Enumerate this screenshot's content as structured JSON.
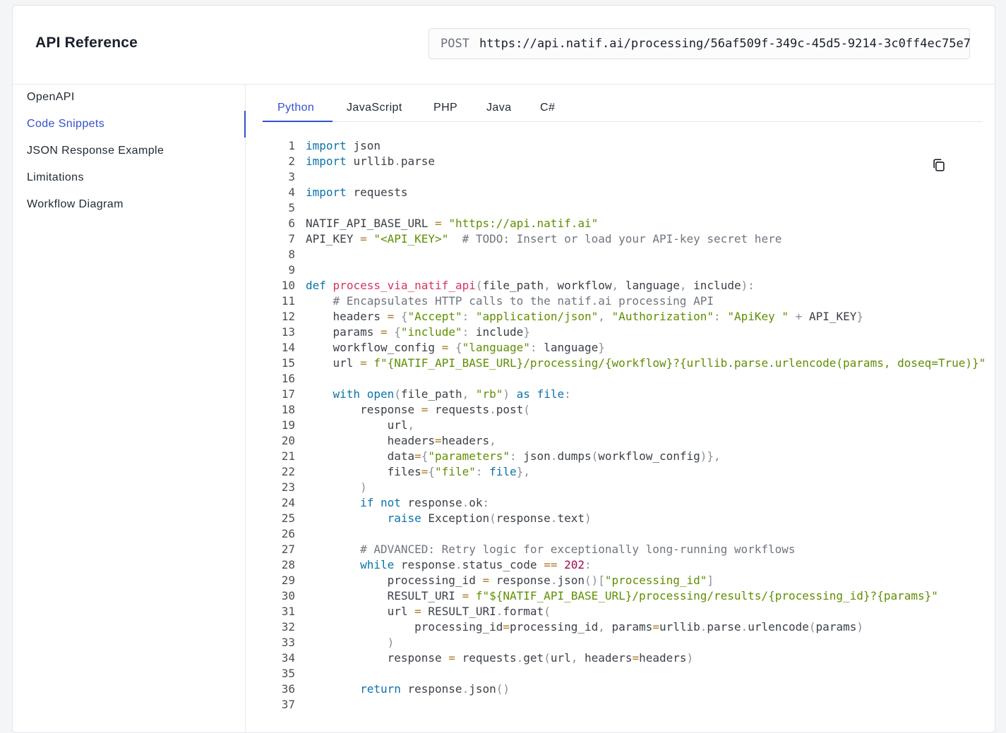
{
  "header": {
    "title": "API Reference",
    "method": "POST",
    "url": "https://api.natif.ai/processing/56af509f-349c-45d5-9214-3c0ff4ec75e7"
  },
  "sidebar": {
    "items": [
      {
        "label": "OpenAPI"
      },
      {
        "label": "Code Snippets",
        "active": true
      },
      {
        "label": "JSON Response Example"
      },
      {
        "label": "Limitations"
      },
      {
        "label": "Workflow Diagram"
      }
    ]
  },
  "tabs": [
    {
      "label": "Python",
      "active": true
    },
    {
      "label": "JavaScript"
    },
    {
      "label": "PHP"
    },
    {
      "label": "Java"
    },
    {
      "label": "C#"
    }
  ],
  "colors": {
    "accent": "#3151c9",
    "keyword": "#0b73a8",
    "string": "#5f8f00",
    "function": "#d6335f",
    "comment": "#6f7680",
    "number": "#9d0a52"
  },
  "icons": {
    "endpoint_copy": "copy-icon",
    "code_copy": "copy-icon"
  },
  "code": {
    "language": "Python",
    "lines": [
      "import json",
      "import urllib.parse",
      "",
      "import requests",
      "",
      "NATIF_API_BASE_URL = \"https://api.natif.ai\"",
      "API_KEY = \"<API_KEY>\"  # TODO: Insert or load your API-key secret here",
      "",
      "",
      "def process_via_natif_api(file_path, workflow, language, include):",
      "    # Encapsulates HTTP calls to the natif.ai processing API",
      "    headers = {\"Accept\": \"application/json\", \"Authorization\": \"ApiKey \" + API_KEY}",
      "    params = {\"include\": include}",
      "    workflow_config = {\"language\": language}",
      "    url = f\"{NATIF_API_BASE_URL}/processing/{workflow}?{urllib.parse.urlencode(params, doseq=True)}\"",
      "",
      "    with open(file_path, \"rb\") as file:",
      "        response = requests.post(",
      "            url,",
      "            headers=headers,",
      "            data={\"parameters\": json.dumps(workflow_config)},",
      "            files={\"file\": file},",
      "        )",
      "        if not response.ok:",
      "            raise Exception(response.text)",
      "",
      "        # ADVANCED: Retry logic for exceptionally long-running workflows",
      "        while response.status_code == 202:",
      "            processing_id = response.json()[\"processing_id\"]",
      "            RESULT_URI = f\"${NATIF_API_BASE_URL}/processing/results/{processing_id}?{params}\"",
      "            url = RESULT_URI.format(",
      "                processing_id=processing_id, params=urllib.parse.urlencode(params)",
      "            )",
      "            response = requests.get(url, headers=headers)",
      "",
      "        return response.json()",
      ""
    ]
  }
}
